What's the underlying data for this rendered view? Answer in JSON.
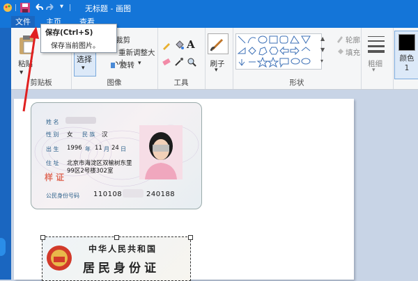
{
  "window": {
    "title": "无标题 - 画图"
  },
  "ribbon_tabs": [
    {
      "label": "文件"
    },
    {
      "label": "主页"
    },
    {
      "label": "查看"
    }
  ],
  "clipboard": {
    "paste_label": "粘贴",
    "group_label": "剪贴板"
  },
  "image": {
    "select_label": "选择",
    "crop_label": "裁剪",
    "resize_label": "重新调整大小",
    "rotate_label": "旋转",
    "group_label": "图像"
  },
  "tools": {
    "group_label": "工具"
  },
  "brushes": {
    "label": "刷子"
  },
  "shapes": {
    "outline_label": "轮廓",
    "fill_label": "填充",
    "group_label": "形状"
  },
  "size": {
    "label": "粗细"
  },
  "color1": {
    "label": "颜色 1"
  },
  "tooltip": {
    "title": "保存(Ctrl+S)",
    "description": "保存当前图片。"
  },
  "id_front": {
    "name_label": "姓 名",
    "sex_label": "性 别",
    "sex": "女",
    "ethnicity_label": "民 族",
    "ethnicity": "汉",
    "birth_label": "出 生",
    "birth_year": "1996",
    "year_unit": "年",
    "birth_month": "11",
    "month_unit": "月",
    "birth_day": "24",
    "day_unit": "日",
    "address_label": "住 址",
    "address_line1": "北京市海淀区双榆树东里",
    "address_line2": "99区2号楼302室",
    "id_label": "公民身份号码",
    "id_prefix": "110108",
    "id_suffix": "240188",
    "stamp": "样证"
  },
  "id_back": {
    "line1": "中华人民共和国",
    "line2": "居民身份证"
  },
  "colors": {
    "accent": "#1475d8",
    "arrow": "#e02020"
  }
}
